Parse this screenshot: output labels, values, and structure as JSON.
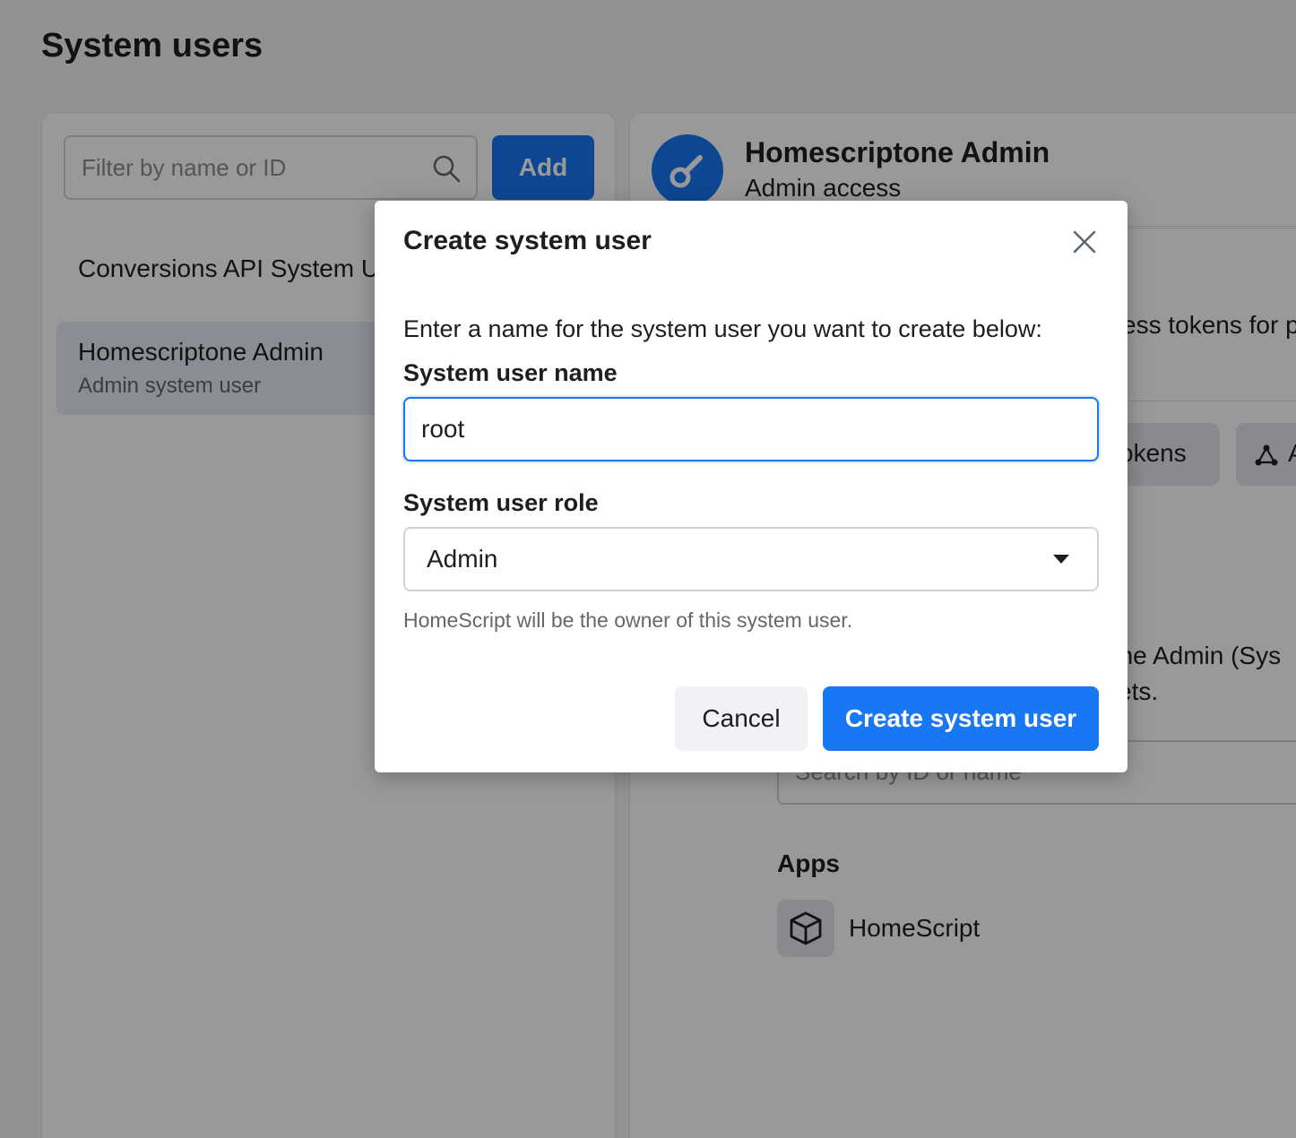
{
  "page": {
    "title": "System users"
  },
  "left_panel": {
    "search": {
      "placeholder": "Filter by name or ID"
    },
    "add_label": "Add",
    "items": [
      {
        "name": "Conversions API System User",
        "subtitle": ""
      },
      {
        "name": "Homescriptone Admin",
        "subtitle": "Admin system user",
        "selected": true
      }
    ]
  },
  "right_panel": {
    "profile_name": "Homescriptone Admin",
    "profile_role": "Admin access",
    "tokens_text": "ess tokens for p",
    "tokens_tab_label": "okens",
    "assets_tab_label": "A",
    "description_line1": "one Admin (Sys",
    "description_line2": "sets.",
    "assets_search_placeholder": "Search by ID or name",
    "apps_heading": "Apps",
    "app_name": "HomeScript"
  },
  "modal": {
    "title": "Create system user",
    "description": "Enter a name for the system user you want to create below:",
    "name_label": "System user name",
    "name_value": "root",
    "role_label": "System user role",
    "role_value": "Admin",
    "owner_note": "HomeScript will be the owner of this system user.",
    "cancel_label": "Cancel",
    "create_label": "Create system user"
  },
  "colors": {
    "accent": "#1877f2",
    "overlay": "rgba(0,0,0,0.4)"
  }
}
